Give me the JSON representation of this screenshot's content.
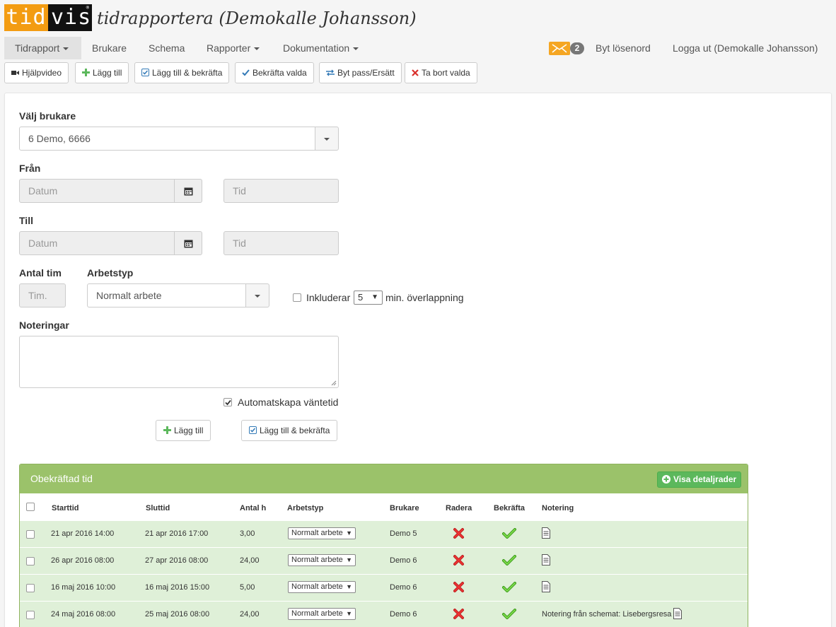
{
  "app": {
    "logo_left": "tid",
    "logo_right": "vis",
    "title": "tidrapportera  (Demokalle Johansson)"
  },
  "nav": {
    "items": [
      {
        "label": "Tidrapport",
        "dropdown": true,
        "active": true
      },
      {
        "label": "Brukare",
        "dropdown": false
      },
      {
        "label": "Schema",
        "dropdown": false
      },
      {
        "label": "Rapporter",
        "dropdown": true
      },
      {
        "label": "Dokumentation",
        "dropdown": true
      }
    ],
    "mail_count": "2",
    "change_password": "Byt lösenord",
    "logout": "Logga ut (Demokalle Johansson)"
  },
  "toolbar": {
    "help_video": "Hjälpvideo",
    "add": "Lägg till",
    "add_confirm": "Lägg till & bekräfta",
    "confirm_selected": "Bekräfta valda",
    "swap_shift": "Byt pass/Ersätt",
    "delete_selected": "Ta bort valda"
  },
  "form": {
    "user_label": "Välj brukare",
    "user_value": "6 Demo,  6666",
    "from_label": "Från",
    "to_label": "Till",
    "date_placeholder": "Datum",
    "time_placeholder": "Tid",
    "hours_label": "Antal tim",
    "hours_placeholder": "Tim.",
    "worktype_label": "Arbetstyp",
    "worktype_value": "Normalt arbete",
    "includes_label": "Inkluderar",
    "overlap_value": "5",
    "overlap_suffix": "min. överlappning",
    "notes_label": "Noteringar",
    "auto_wait_label": "Automatskapa väntetid",
    "auto_wait_checked": true,
    "add_button": "Lägg till",
    "add_confirm_button": "Lägg till & bekräfta"
  },
  "table": {
    "title": "Obekräftad tid",
    "details_button": "Visa detaljrader",
    "columns": [
      "Starttid",
      "Sluttid",
      "Antal h",
      "Arbetstyp",
      "Brukare",
      "Radera",
      "Bekräfta",
      "Notering"
    ],
    "rows": [
      {
        "start": "21 apr 2016 14:00",
        "end": "21 apr 2016 17:00",
        "hours": "3,00",
        "type": "Normalt arbete",
        "user": "Demo 5",
        "note": ""
      },
      {
        "start": "26 apr 2016 08:00",
        "end": "27 apr 2016 08:00",
        "hours": "24,00",
        "type": "Normalt arbete",
        "user": "Demo 6",
        "note": ""
      },
      {
        "start": "16 maj 2016 10:00",
        "end": "16 maj 2016 15:00",
        "hours": "5,00",
        "type": "Normalt arbete",
        "user": "Demo 6",
        "note": ""
      },
      {
        "start": "24 maj 2016 08:00",
        "end": "25 maj 2016 08:00",
        "hours": "24,00",
        "type": "Normalt arbete",
        "user": "Demo 6",
        "note": "Notering från schemat: Lisebergsresa"
      }
    ]
  },
  "colors": {
    "logo_orange": "#f39c12",
    "panel_green": "#9bc26a",
    "row_green": "#dff0d8",
    "button_green": "#5cb85c"
  }
}
